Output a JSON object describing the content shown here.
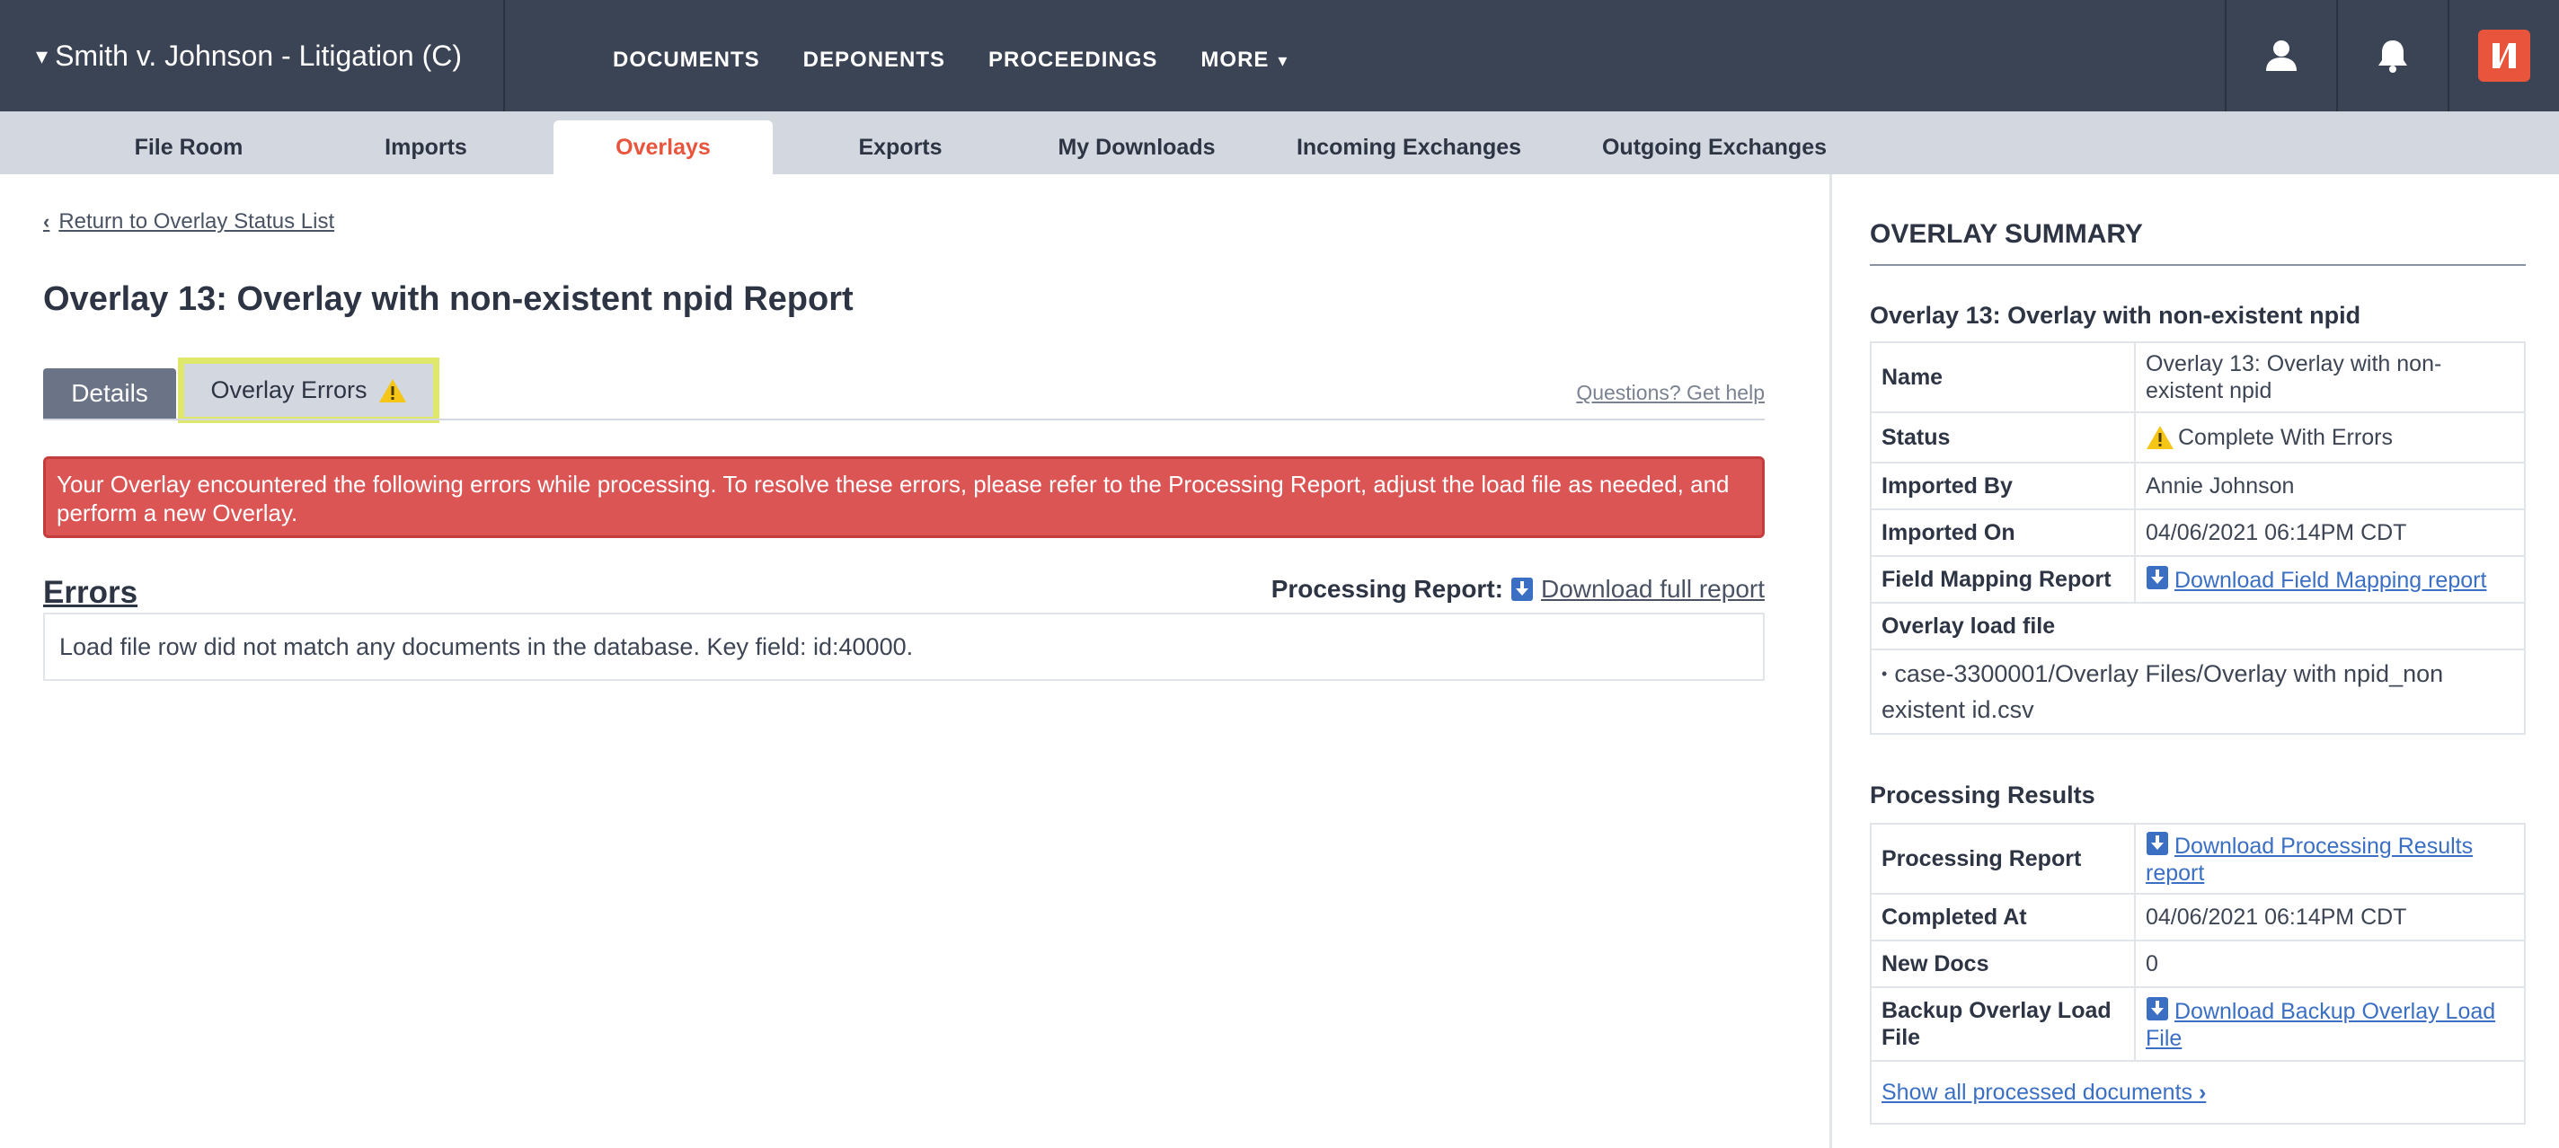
{
  "topbar": {
    "case_title": "Smith v. Johnson - Litigation (C)",
    "caret": "▾",
    "nav": [
      "DOCUMENTS",
      "DEPONENTS",
      "PROCEEDINGS",
      "MORE"
    ],
    "more_caret": "▾",
    "icons": [
      "user-icon",
      "bell-icon",
      "brand-logo"
    ]
  },
  "subnav": {
    "tabs": [
      "File Room",
      "Imports",
      "Overlays",
      "Exports",
      "My Downloads",
      "Incoming Exchanges",
      "Outgoing Exchanges"
    ],
    "active": "Overlays"
  },
  "main": {
    "back_link": "Return to Overlay Status List",
    "title": "Overlay 13: Overlay with non-existent npid Report",
    "tabs": {
      "details": "Details",
      "errors": "Overlay Errors"
    },
    "help_link": "Questions? Get help",
    "alert": "Your Overlay encountered the following errors while processing. To resolve these errors, please refer to the Processing Report, adjust the load file as needed, and perform a new Overlay.",
    "errors_heading": "Errors",
    "processing_report_label": "Processing Report:",
    "download_full_report": "Download full report",
    "error_rows": [
      "Load file row did not match any documents in the database. Key field: id:40000."
    ]
  },
  "summary": {
    "title": "OVERLAY SUMMARY",
    "overlay_name_heading": "Overlay 13: Overlay with non-existent npid",
    "rows": {
      "name_label": "Name",
      "name_value": "Overlay 13: Overlay with non-existent npid",
      "status_label": "Status",
      "status_value": "Complete With Errors",
      "imported_by_label": "Imported By",
      "imported_by_value": "Annie Johnson",
      "imported_on_label": "Imported On",
      "imported_on_value": "04/06/2021 06:14PM CDT",
      "field_mapping_label": "Field Mapping Report",
      "field_mapping_link": "Download Field Mapping report",
      "load_file_label": "Overlay load file",
      "load_file_value": "case-3300001/Overlay Files/Overlay with npid_non existent id.csv"
    },
    "processing": {
      "heading": "Processing Results",
      "report_label": "Processing Report",
      "report_link": "Download Processing Results report",
      "completed_label": "Completed At",
      "completed_value": "04/06/2021 06:14PM CDT",
      "new_docs_label": "New Docs",
      "new_docs_value": "0",
      "backup_label": "Backup Overlay Load File",
      "backup_link": "Download Backup Overlay Load File",
      "show_all": "Show all processed documents"
    }
  },
  "colors": {
    "topbar": "#3b4455",
    "subnav": "#d3d8e0",
    "accent": "#e8543c",
    "alert": "#dc5555",
    "highlight": "#dfe86a",
    "link": "#3a6fc4",
    "warning": "#f5c518"
  }
}
